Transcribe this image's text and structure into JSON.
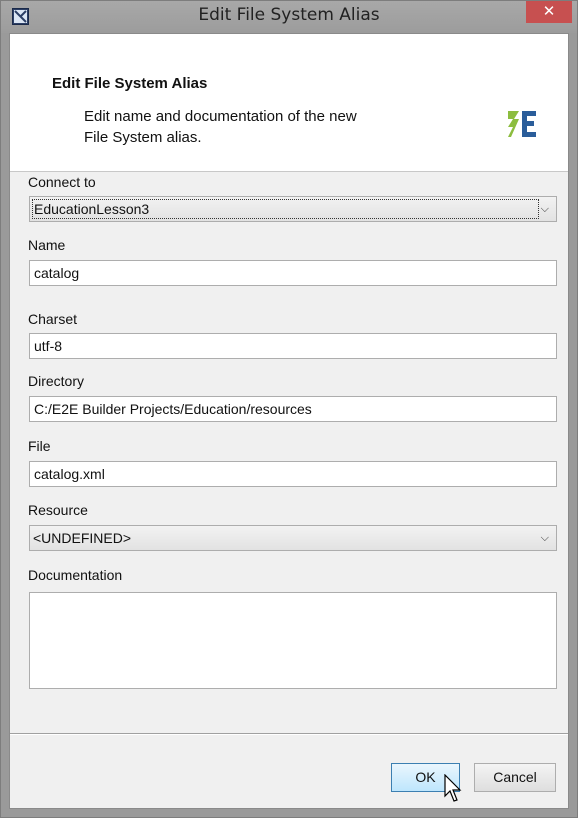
{
  "window": {
    "title": "Edit File System Alias",
    "close_glyph": "✕"
  },
  "header": {
    "title": "Edit File System Alias",
    "description_line1": "Edit name and documentation of the new",
    "description_line2": "File System alias."
  },
  "form": {
    "connect_to": {
      "label": "Connect to",
      "value": "EducationLesson3"
    },
    "name": {
      "label": "Name",
      "value": "catalog"
    },
    "charset": {
      "label": "Charset",
      "value": "utf-8"
    },
    "directory": {
      "label": "Directory",
      "value": "C:/E2E Builder Projects/Education/resources"
    },
    "file": {
      "label": "File",
      "value": "catalog.xml"
    },
    "resource": {
      "label": "Resource",
      "value": "<UNDEFINED>"
    },
    "documentation": {
      "label": "Documentation",
      "value": ""
    }
  },
  "buttons": {
    "ok": "OK",
    "cancel": "Cancel"
  },
  "icons": {
    "app": "app-window-icon",
    "logo": "e2e-logo-icon",
    "dropdown": "chevron-down-icon",
    "cursor": "mouse-pointer-icon"
  },
  "colors": {
    "close_button": "#c75050",
    "logo_green": "#8cbd3f",
    "logo_blue": "#2a5d9a",
    "ok_border": "#3c7fb1"
  }
}
